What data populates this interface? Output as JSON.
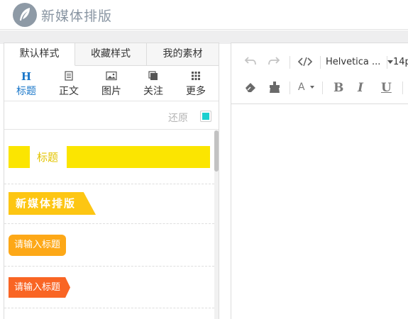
{
  "header": {
    "brand": "新媒体排版"
  },
  "left_panel": {
    "tabs": [
      {
        "label": "默认样式",
        "active": true
      },
      {
        "label": "收藏样式",
        "active": false
      },
      {
        "label": "我的素材",
        "active": false
      }
    ],
    "categories": [
      {
        "label": "标题",
        "icon": "heading-icon",
        "glyph": "H",
        "active": true
      },
      {
        "label": "正文",
        "icon": "text-doc-icon",
        "active": false
      },
      {
        "label": "图片",
        "icon": "image-icon",
        "active": false
      },
      {
        "label": "关注",
        "icon": "follow-icon",
        "active": false
      },
      {
        "label": "更多",
        "icon": "grid-icon",
        "active": false
      }
    ],
    "restore_label": "还原",
    "swatch_color": "#1ccfcf",
    "styles": [
      {
        "text": "标题",
        "color": "#fbe501"
      },
      {
        "text": "新媒体排版",
        "color": "#fdc613"
      },
      {
        "text": "请输入标题",
        "color": "#fda817"
      },
      {
        "text": "请输入标题",
        "color": "#f96524"
      }
    ]
  },
  "editor": {
    "font_family": "Helvetica ...",
    "font_size": "14p",
    "toolbar_icons": [
      "undo-icon",
      "redo-icon",
      "code-icon",
      "eraser-icon",
      "brush-icon",
      "font-color-icon",
      "bold-icon",
      "italic-icon",
      "underline-icon"
    ],
    "font_color_label": "A",
    "bold_label": "B",
    "italic_label": "I",
    "underline_label": "U"
  }
}
